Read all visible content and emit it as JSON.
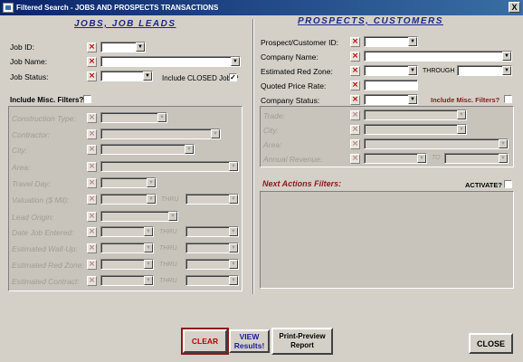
{
  "window": {
    "title": "Filtered Search - JOBS AND PROSPECTS TRANSACTIONS",
    "close": "X"
  },
  "jobs": {
    "title": "JOBS, JOB LEADS",
    "job_id": "Job ID:",
    "job_name": "Job Name:",
    "job_status": "Job Status:",
    "include_closed": "Include CLOSED Jobs?",
    "include_closed_checked": "✓",
    "include_misc": "Include Misc. Filters?",
    "misc": {
      "construction_type": "Construction Type:",
      "contractor": "Contractor:",
      "city": "City:",
      "area": "Area:",
      "travel_day": "Travel Day:",
      "valuation": "Valuation ($ Mil):",
      "lead_origin": "Lead Origin:",
      "date_entered": "Date Job Entered:",
      "est_wrapup": "Estimated Wall-Up:",
      "est_red_zone": "Estimated Red Zone:",
      "est_contract": "Estimated Contract:",
      "thru": "THRU"
    }
  },
  "prospects": {
    "title": "PROSPECTS, CUSTOMERS",
    "prospect_id": "Prospect/Customer ID:",
    "company_name": "Company Name:",
    "est_red_zone": "Estimated Red Zone:",
    "through": "THROUGH",
    "quoted_price_rate": "Quoted Price Rate:",
    "company_status": "Company Status:",
    "include_misc": "Include Misc. Filters?",
    "misc": {
      "trade": "Trade:",
      "city": "City:",
      "area": "Area:",
      "annual_revenue": "Annual Revenue:",
      "to": "TO"
    }
  },
  "next_actions": {
    "title": "Next Actions Filters:",
    "activate": "ACTIVATE?"
  },
  "buttons": {
    "clear": "CLEAR",
    "view": "VIEW Results!",
    "print": "Print-Preview Report",
    "close": "CLOSE"
  },
  "colors": {
    "title_bar": "#0a246a",
    "section_title": "#1a2a8a",
    "x_icon": "#c00000",
    "clear_text": "#c00000",
    "view_text": "#1a1aa0"
  }
}
